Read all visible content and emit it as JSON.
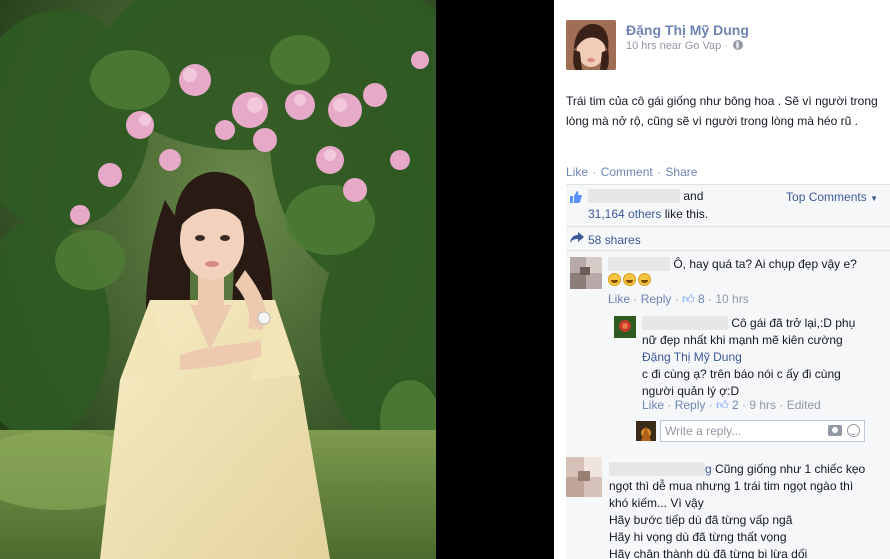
{
  "post": {
    "author": "Đặng Thị Mỹ Dung",
    "time": "10 hrs",
    "location_prefix": "near",
    "location": "Go Vap",
    "text": "Trái tim của cô gái giống như bông hoa . Sẽ vì người trong lòng mà nở rộ, cũng sẽ vì người trong lòng mà héo rũ .",
    "actions": {
      "like": "Like",
      "comment": "Comment",
      "share": "Share"
    },
    "likes_and": "and",
    "likes_others": "31,164 others",
    "likes_suffix": "like this.",
    "top_comments": "Top Comments",
    "shares": "58 shares"
  },
  "comments": [
    {
      "text": "Ô, hay quá ta? Ai chụp đẹp vậy e?",
      "emoji_count": 3,
      "like": "Like",
      "reply": "Reply",
      "likes": "8",
      "time": "10 hrs"
    },
    {
      "text_line1": "Cô gái đã trở lại,:D phụ",
      "text_line2": "nữ đẹp nhất khi mạnh mẽ kiên cường",
      "mention": "Đặng Thị Mỹ Dung",
      "text_line3": "c đi cùng ạ? trên báo nói c ấy đi cùng",
      "text_line4": "người quản lý ợ:D",
      "like": "Like",
      "reply": "Reply",
      "likes": "2",
      "time": "9 hrs",
      "edited": "Edited"
    },
    {
      "name_tail": "g",
      "lines": [
        "Cũng giống như 1 chiếc kẹo",
        "ngọt thì dễ mua nhưng 1 trái tim ngọt ngào thì",
        "khó kiếm... Vì vậy",
        "Hãy bước tiếp dù đã từng vấp ngã",
        "Hãy hi vọng dù đã từng thất vọng",
        "Hãy chân thành dù đã từng bị lừa dối"
      ]
    }
  ],
  "reply_box": {
    "placeholder": "Write a reply..."
  },
  "colors": {
    "link": "#3b5998",
    "action": "#6d84b4",
    "muted": "#9197a3",
    "box": "#f6f7f8"
  }
}
